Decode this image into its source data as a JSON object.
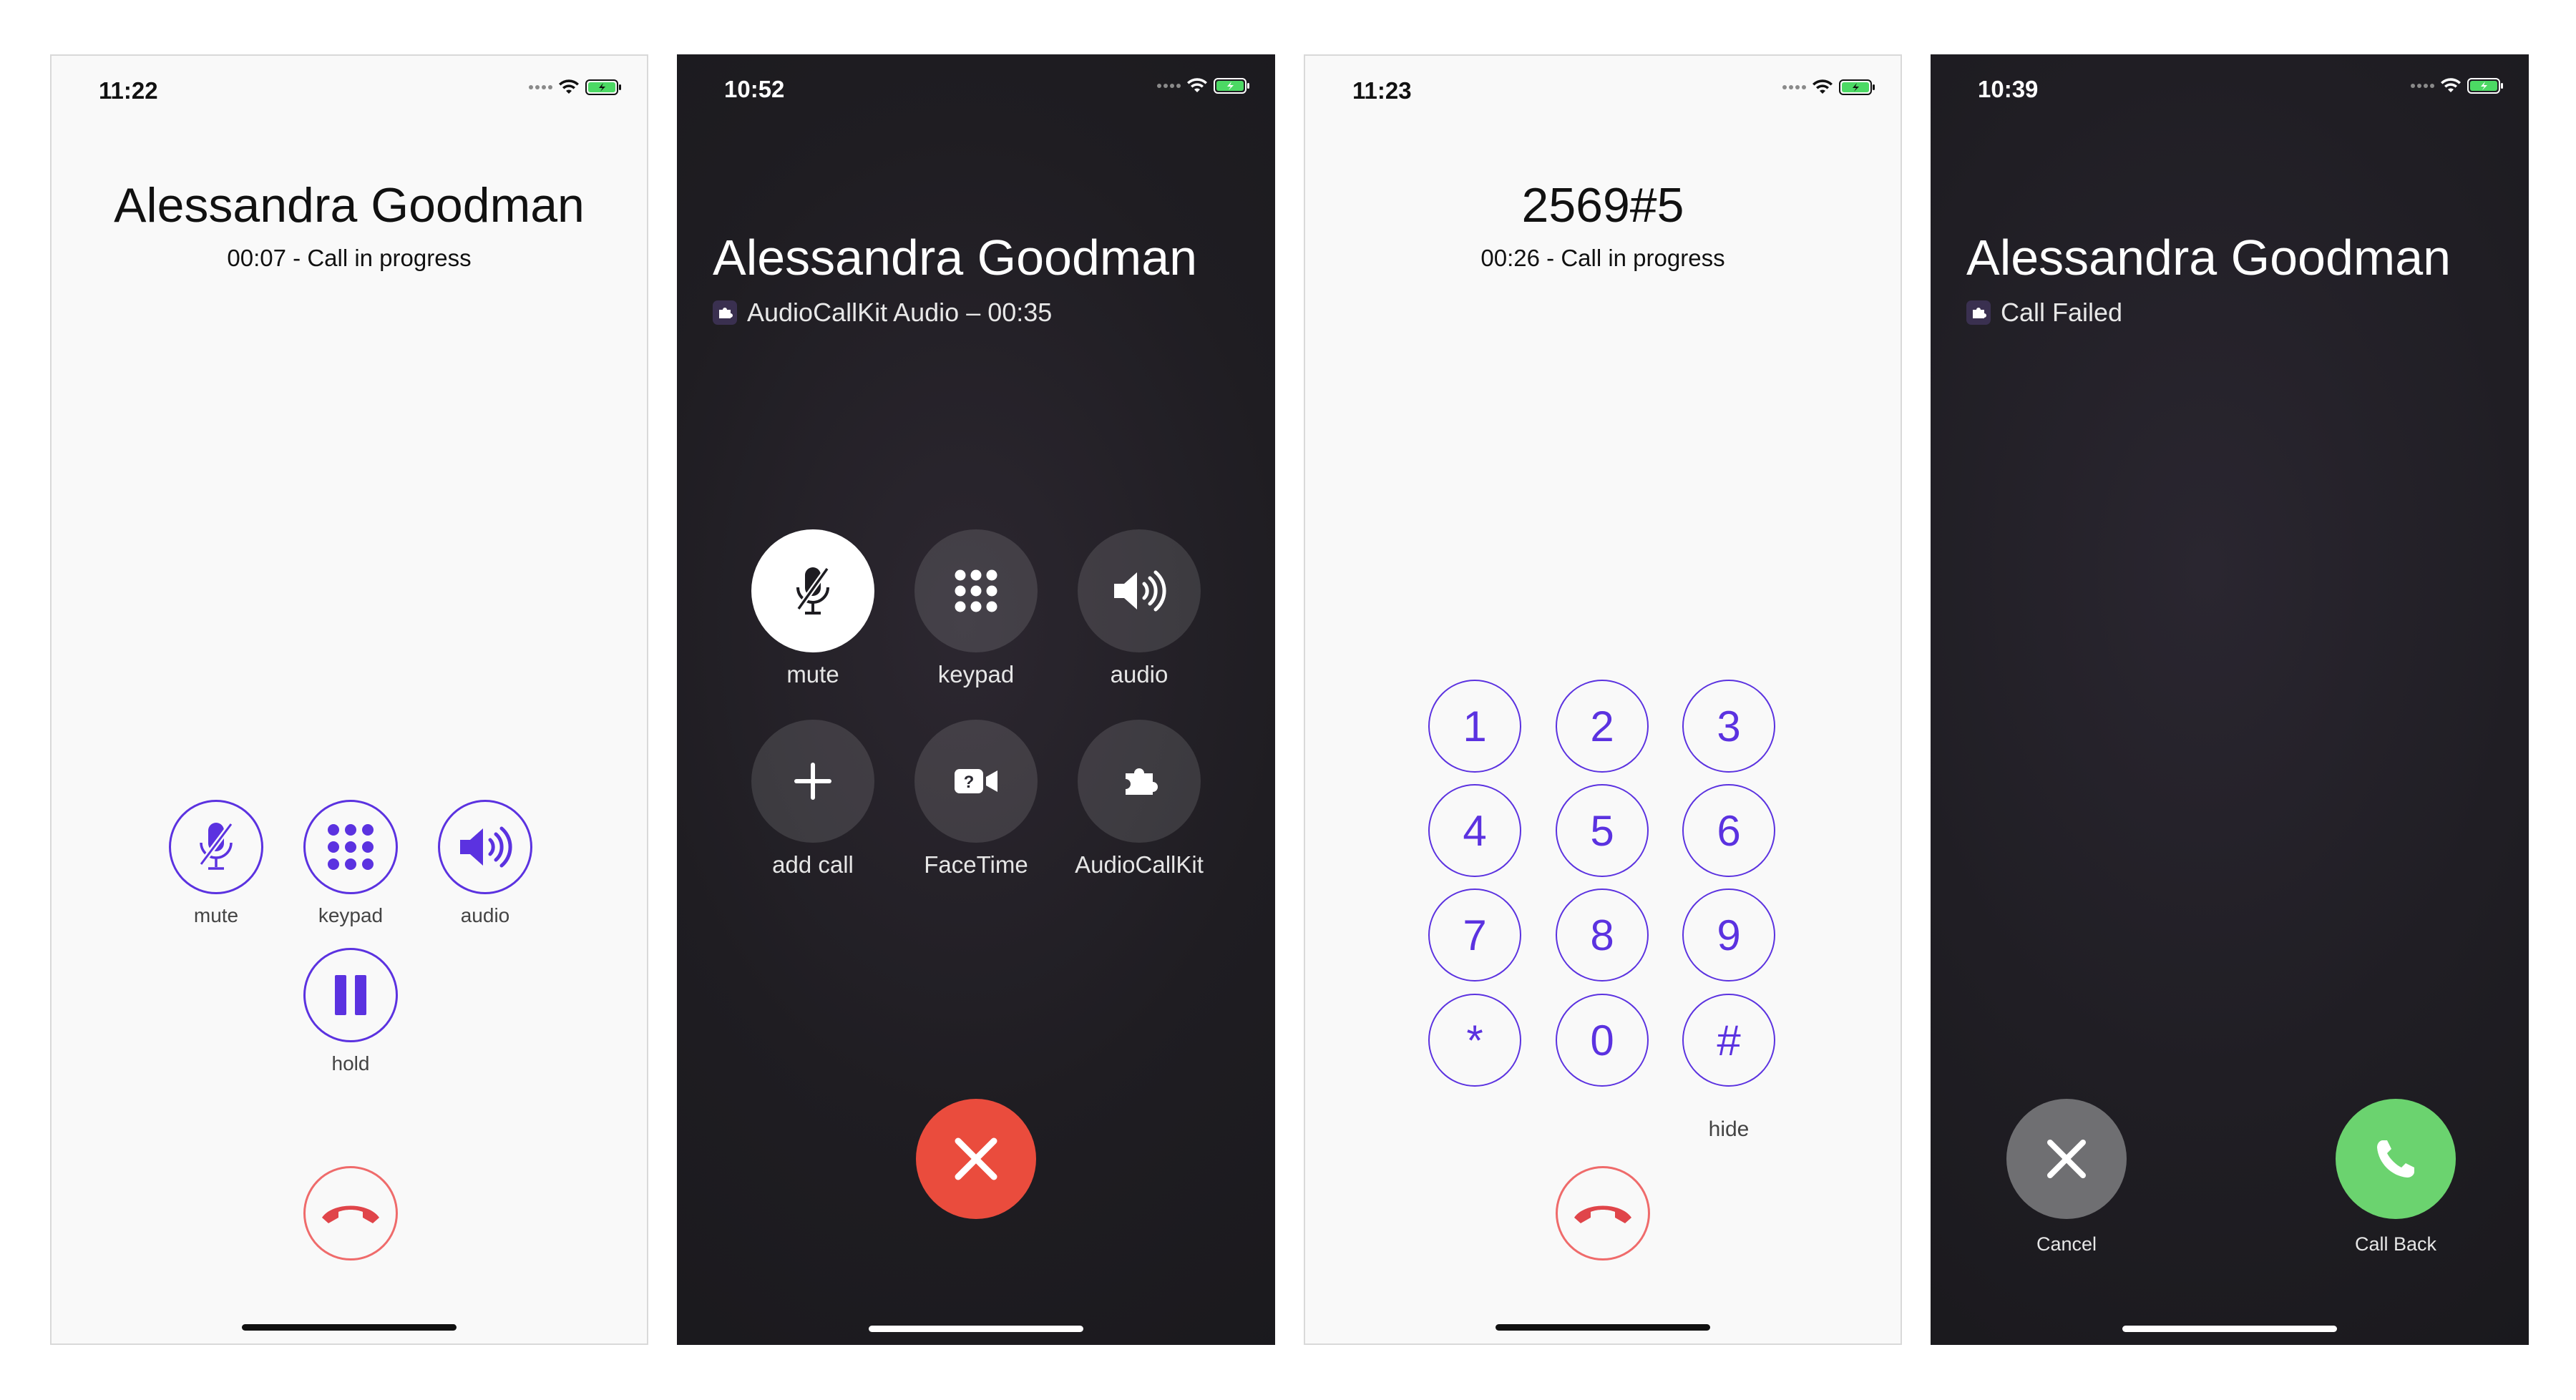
{
  "screens": [
    {
      "time": "11:22",
      "contact": "Alessandra Goodman",
      "subtitle": "00:07 - Call in progress",
      "buttons": {
        "mute": "mute",
        "keypad": "keypad",
        "audio": "audio",
        "hold": "hold"
      }
    },
    {
      "time": "10:52",
      "contact": "Alessandra Goodman",
      "subtitle": "AudioCallKit Audio – 00:35",
      "buttons": {
        "mute": "mute",
        "keypad": "keypad",
        "audio": "audio",
        "add_call": "add call",
        "facetime": "FaceTime",
        "app": "AudioCallKit"
      }
    },
    {
      "time": "11:23",
      "dialed": "2569#5",
      "subtitle": "00:26 - Call in progress",
      "keys": [
        "1",
        "2",
        "3",
        "4",
        "5",
        "6",
        "7",
        "8",
        "9",
        "*",
        "0",
        "#"
      ],
      "hide": "hide"
    },
    {
      "time": "10:39",
      "contact": "Alessandra Goodman",
      "subtitle": "Call Failed",
      "cancel": "Cancel",
      "call_back": "Call Back"
    }
  ],
  "colors": {
    "accent": "#5b32e0",
    "end_call_red": "#ea4c3d",
    "end_call_outline": "#ef6b6b",
    "call_back_green": "#6bd36f",
    "cancel_gray": "#6f6f72",
    "battery_green": "#4cd964"
  }
}
